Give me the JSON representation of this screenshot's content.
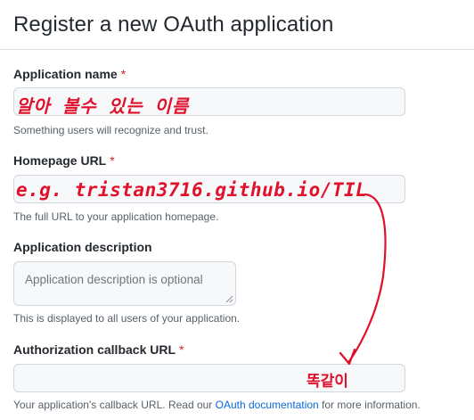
{
  "page": {
    "title": "Register a new OAuth application"
  },
  "form": {
    "app_name": {
      "label": "Application name",
      "required_mark": "*",
      "handwritten_value": "알아 볼수 있는 이름",
      "hint": "Something users will recognize and trust."
    },
    "homepage_url": {
      "label": "Homepage URL",
      "required_mark": "*",
      "handwritten_value": "e.g. tristan3716.github.io/TIL",
      "hint": "The full URL to your application homepage."
    },
    "description": {
      "label": "Application description",
      "placeholder": "Application description is optional",
      "hint": "This is displayed to all users of your application."
    },
    "callback_url": {
      "label": "Authorization callback URL",
      "required_mark": "*",
      "handwritten_note": "똑같이",
      "hint_prefix": "Your application's callback URL. Read our ",
      "hint_link": "OAuth documentation",
      "hint_suffix": " for more information."
    }
  },
  "colors": {
    "annotation": "#e0112b",
    "link": "#0969da",
    "required": "#cf222e"
  }
}
